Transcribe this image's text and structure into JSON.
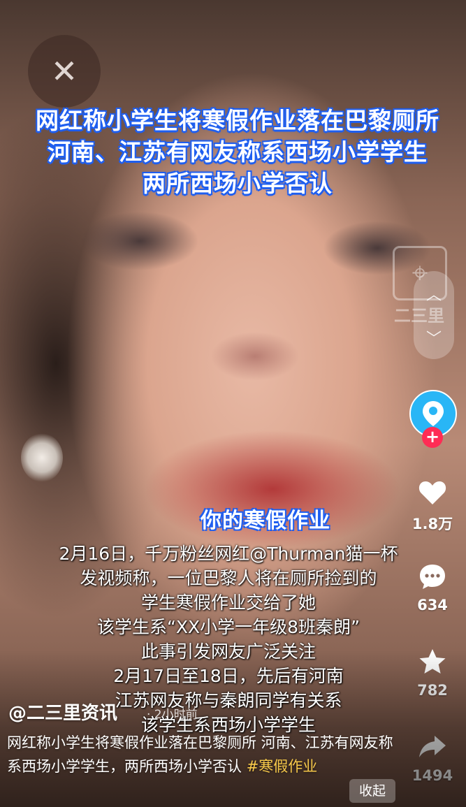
{
  "video": {
    "headline_lines": [
      "网红称小学生将寒假作业落在巴黎厕所",
      "河南、江苏有网友称系西场小学学生",
      "两所西场小学否认"
    ],
    "overlay_text": "你的寒假作业",
    "caption_lines": [
      "2月16日，千万粉丝网红@Thurman猫一杯",
      "发视频称，一位巴黎人将在厕所捡到的",
      "学生寒假作业交给了她",
      "该学生系“XX小学一年级8班秦朗”",
      "此事引发网友广泛关注",
      "2月17日至18日，先后有河南",
      "江苏网友称与秦朗同学有关系",
      "该学生系西场小学学生"
    ],
    "watermark_text": "二三里"
  },
  "actions": {
    "likes": "1.8万",
    "comments": "634",
    "favorites": "782",
    "shares": "1494"
  },
  "post": {
    "author": "@二三里资讯",
    "time": "· 2小时前",
    "description": "网红称小学生将寒假作业落在巴黎厕所 河南、江苏有网友称系西场小学学生，两所西场小学否认 ",
    "hashtag": "#寒假作业",
    "collapse_label": "收起"
  },
  "colors": {
    "headline_stroke": "#1f5ff0",
    "hashtag": "#f7c94a",
    "follow_plus": "#fe2c55",
    "avatar_bg": "#29b6f6"
  },
  "icons": [
    "close-icon",
    "location-pin-icon",
    "chevron-up-icon",
    "chevron-down-icon",
    "plus-icon",
    "heart-icon",
    "comment-icon",
    "star-icon",
    "share-icon"
  ]
}
